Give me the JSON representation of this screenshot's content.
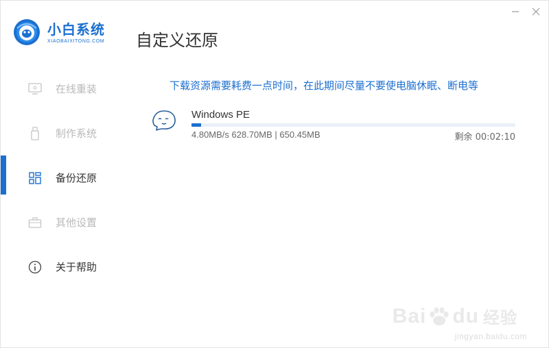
{
  "window": {
    "controls": {
      "minimize_icon": "minimize-icon",
      "close_icon": "close-icon"
    }
  },
  "brand": {
    "name_cn": "小白系统",
    "name_en": "XIAOBAIXITONG.COM",
    "color": "#1b6fd1"
  },
  "page": {
    "title": "自定义还原"
  },
  "sidebar": {
    "items": [
      {
        "label": "在线重装",
        "icon": "monitor-icon",
        "active": false
      },
      {
        "label": "制作系统",
        "icon": "usb-drive-icon",
        "active": false
      },
      {
        "label": "备份还原",
        "icon": "grid-icon",
        "active": true
      },
      {
        "label": "其他设置",
        "icon": "briefcase-icon",
        "active": false
      },
      {
        "label": "关于帮助",
        "icon": "info-circle-icon",
        "active": false
      }
    ]
  },
  "main": {
    "notice": "下载资源需要耗费一点时间，在此期间尽量不要使电脑休眠、断电等",
    "download": {
      "icon": "smiley-cloud-icon",
      "name": "Windows PE",
      "stats": "4.80MB/s 628.70MB | 650.45MB",
      "remaining": "剩余 00:02:10",
      "progress_percent": 3
    }
  },
  "watermark": {
    "brand_left": "Bai",
    "brand_right": "du",
    "brand_cn": "经验",
    "url": "jingyan.baidu.com"
  }
}
